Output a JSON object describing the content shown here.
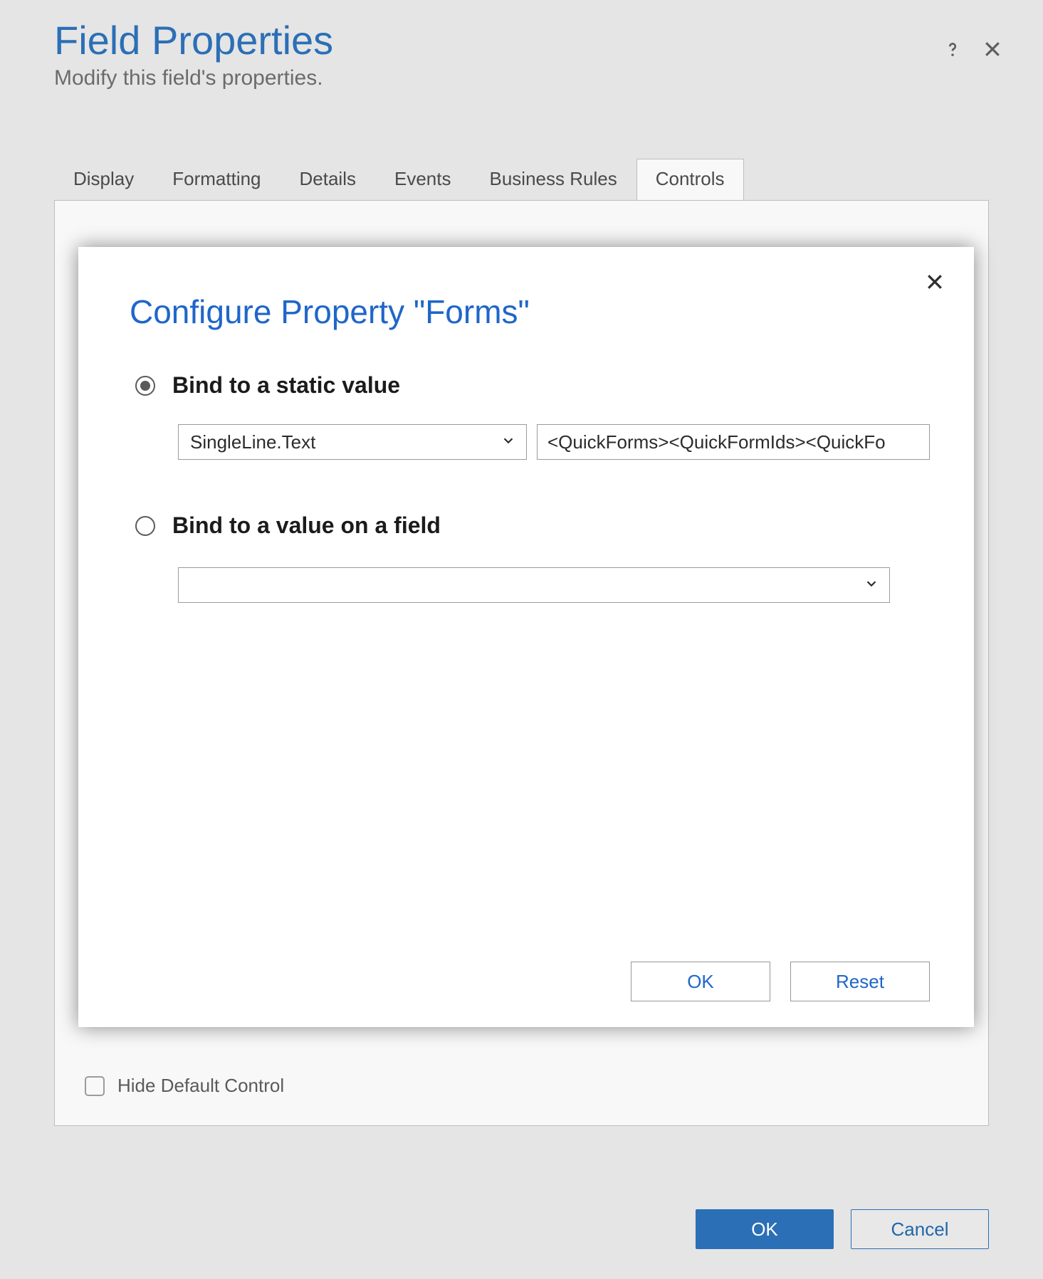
{
  "header": {
    "title": "Field Properties",
    "subtitle": "Modify this field's properties."
  },
  "tabs": {
    "items": [
      {
        "label": "Display"
      },
      {
        "label": "Formatting"
      },
      {
        "label": "Details"
      },
      {
        "label": "Events"
      },
      {
        "label": "Business Rules"
      },
      {
        "label": "Controls"
      }
    ]
  },
  "tab_content": {
    "hide_default_label": "Hide Default Control"
  },
  "footer": {
    "ok": "OK",
    "cancel": "Cancel"
  },
  "modal": {
    "title": "Configure Property \"Forms\"",
    "option_static_label": "Bind to a static value",
    "static_type": "SingleLine.Text",
    "static_value": "<QuickForms><QuickFormIds><QuickFo",
    "option_field_label": "Bind to a value on a field",
    "field_value": "",
    "ok": "OK",
    "reset": "Reset"
  }
}
